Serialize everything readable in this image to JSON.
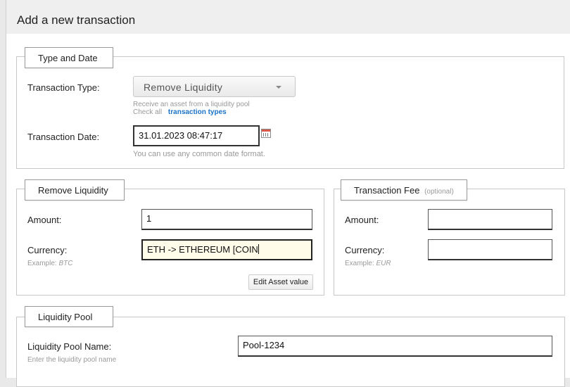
{
  "dialog": {
    "title": "Add a new transaction"
  },
  "type_date": {
    "legend": "Type and Date",
    "transaction_type_label": "Transaction Type:",
    "transaction_type_value": "Remove Liquidity",
    "type_hint": "Receive an asset from a liquidity pool",
    "check_all_text": "Check all",
    "transaction_types_link": "transaction types",
    "transaction_date_label": "Transaction Date:",
    "transaction_date_value": "31.01.2023 08:47:17",
    "date_hint": "You can use any common date format."
  },
  "remove_liquidity": {
    "legend": "Remove Liquidity",
    "amount_label": "Amount:",
    "amount_value": "1",
    "currency_label": "Currency:",
    "currency_value": "ETH -> ETHEREUM [COIN",
    "example_label": "Example:",
    "example_value": "BTC",
    "edit_asset_button": "Edit Asset value"
  },
  "transaction_fee": {
    "legend": "Transaction Fee",
    "optional_text": "(optional)",
    "amount_label": "Amount:",
    "amount_value": "",
    "currency_label": "Currency:",
    "currency_value": "",
    "example_label": "Example:",
    "example_value": "EUR"
  },
  "liquidity_pool": {
    "legend": "Liquidity Pool",
    "name_label": "Liquidity Pool Name:",
    "name_value": "Pool-1234",
    "name_hint": "Enter the liquidity pool name"
  }
}
